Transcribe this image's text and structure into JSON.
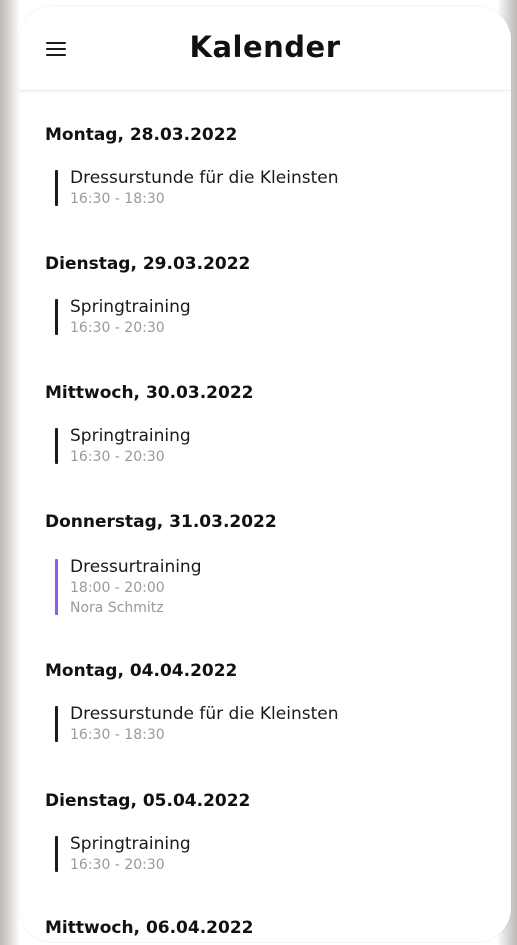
{
  "header": {
    "title": "Kalender",
    "menu_icon": "hamburger-menu-icon"
  },
  "days": [
    {
      "date": "Montag, 28.03.2022",
      "events": [
        {
          "title": "Dressurstunde für die Kleinsten",
          "time": "16:30 - 18:30",
          "color": "#1a1a1a"
        }
      ]
    },
    {
      "date": "Dienstag, 29.03.2022",
      "events": [
        {
          "title": "Springtraining",
          "time": "16:30 - 20:30",
          "color": "#1a1a1a"
        }
      ]
    },
    {
      "date": "Mittwoch, 30.03.2022",
      "events": [
        {
          "title": "Springtraining",
          "time": "16:30 - 20:30",
          "color": "#1a1a1a"
        }
      ]
    },
    {
      "date": "Donnerstag, 31.03.2022",
      "events": [
        {
          "title": "Dressurtraining",
          "time": "18:00 - 20:00",
          "person": "Nora Schmitz",
          "color": "#8a5cf0"
        }
      ]
    },
    {
      "date": "Montag, 04.04.2022",
      "events": [
        {
          "title": "Dressurstunde für die Kleinsten",
          "time": "16:30 - 18:30",
          "color": "#1a1a1a"
        }
      ]
    },
    {
      "date": "Dienstag, 05.04.2022",
      "events": [
        {
          "title": "Springtraining",
          "time": "16:30 - 20:30",
          "color": "#1a1a1a"
        }
      ]
    },
    {
      "date": "Mittwoch, 06.04.2022",
      "events": []
    }
  ]
}
